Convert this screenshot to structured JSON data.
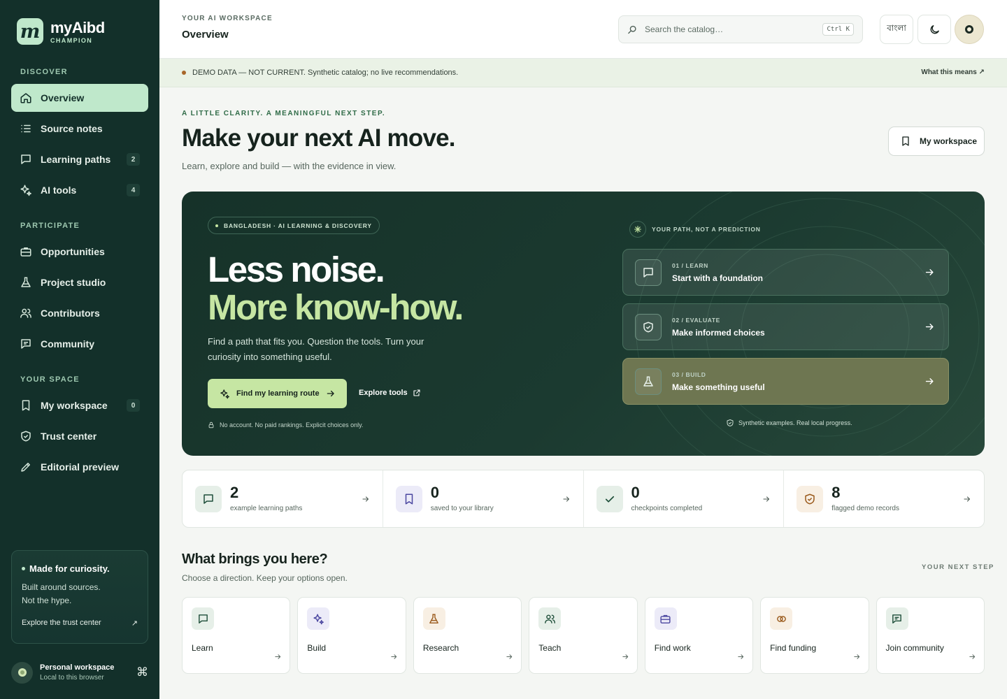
{
  "brand": {
    "logo_letter": "m",
    "name": "myAibd",
    "subtitle": "CHAMPION"
  },
  "sidebar": {
    "sections": [
      "DISCOVER",
      "PARTICIPATE",
      "YOUR SPACE"
    ],
    "items": [
      {
        "label": "Overview",
        "icon": "home-icon",
        "active": true
      },
      {
        "label": "Source notes",
        "icon": "list-icon"
      },
      {
        "label": "Learning paths",
        "icon": "chat-square-icon",
        "count": "2"
      },
      {
        "label": "AI tools",
        "icon": "sparkle-icon",
        "count": "4"
      },
      {
        "label": "Opportunities",
        "icon": "briefcase-icon"
      },
      {
        "label": "Project studio",
        "icon": "flask-icon"
      },
      {
        "label": "Contributors",
        "icon": "users-icon"
      },
      {
        "label": "Community",
        "icon": "message-icon"
      },
      {
        "label": "My workspace",
        "icon": "bookmark-icon",
        "count": "0"
      },
      {
        "label": "Trust center",
        "icon": "shield-check-icon"
      },
      {
        "label": "Editorial preview",
        "icon": "pencil-icon"
      }
    ],
    "curiosity": {
      "title": "Made for curiosity.",
      "line1": "Built around sources.",
      "line2": "Not the hype.",
      "link": "Explore the trust center",
      "link_icon": "↗"
    },
    "workspace": {
      "name": "Personal workspace",
      "sub": "Local to this browser",
      "shortcut": "⌘"
    }
  },
  "header": {
    "eyebrow": "YOUR AI WORKSPACE",
    "title": "Overview",
    "search_placeholder": "Search the catalog…",
    "search_kbd": "Ctrl K",
    "lang_label": "বাংলা"
  },
  "banner": {
    "text": "DEMO DATA — NOT CURRENT. Synthetic catalog; no live recommendations.",
    "link": "What this means ↗",
    "dot_color": "#a8662a"
  },
  "intro": {
    "eyebrow": "A LITTLE CLARITY. A MEANINGFUL NEXT STEP.",
    "title": "Make your next AI move.",
    "subtitle": "Learn, explore and build — with the evidence in view.",
    "workspace_button": "My workspace"
  },
  "hero": {
    "tag": "BANGLADESH · AI LEARNING & DISCOVERY",
    "headline1": "Less noise.",
    "headline2": "More know-how.",
    "body": "Find a path that fits you. Question the tools. Turn your curiosity into something useful.",
    "primary_button": "Find my learning route",
    "secondary_link": "Explore tools",
    "note": "No account. No paid rankings. Explicit choices only.",
    "path_label": "YOUR PATH, NOT A PREDICTION",
    "steps": [
      {
        "step": "01 / LEARN",
        "title": "Start with a foundation",
        "icon": "chat-square-icon"
      },
      {
        "step": "02 / EVALUATE",
        "title": "Make informed choices",
        "icon": "shield-check-icon"
      },
      {
        "step": "03 / BUILD",
        "title": "Make something useful",
        "icon": "flask-icon"
      }
    ],
    "footnote": "Synthetic examples. Real local progress.",
    "accent": "#c6e6a3",
    "background": "#1b3a30"
  },
  "stats": [
    {
      "value": "2",
      "label": "example learning paths",
      "icon": "chat-square-icon"
    },
    {
      "value": "0",
      "label": "saved to your library",
      "icon": "bookmark-icon"
    },
    {
      "value": "0",
      "label": "checkpoints completed",
      "icon": "check-icon"
    },
    {
      "value": "8",
      "label": "flagged demo records",
      "icon": "shield-check-icon"
    }
  ],
  "directions": {
    "title": "What brings you here?",
    "subtitle": "Choose a direction. Keep your options open.",
    "right_label": "YOUR NEXT STEP",
    "cards": [
      {
        "label": "Learn",
        "icon": "chat-square-icon"
      },
      {
        "label": "Build",
        "icon": "sparkle-icon"
      },
      {
        "label": "Research",
        "icon": "flask-icon"
      },
      {
        "label": "Teach",
        "icon": "users-icon"
      },
      {
        "label": "Find work",
        "icon": "briefcase-icon"
      },
      {
        "label": "Find funding",
        "icon": "coins-icon"
      },
      {
        "label": "Join community",
        "icon": "message-icon"
      }
    ]
  }
}
